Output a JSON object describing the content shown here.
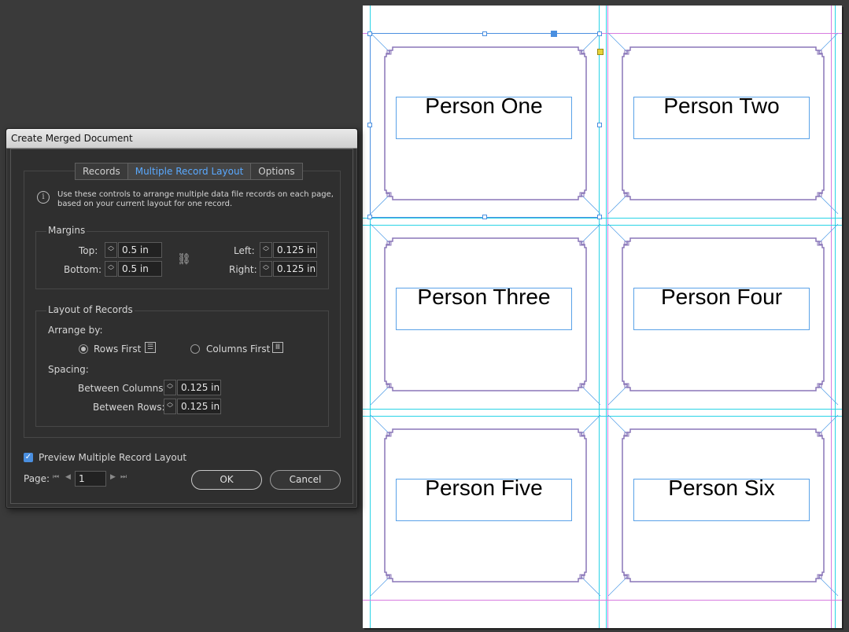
{
  "dialog": {
    "title": "Create Merged Document",
    "tabs": [
      "Records",
      "Multiple Record Layout",
      "Options"
    ],
    "active_tab": "Multiple Record Layout",
    "info_line1": "Use these controls to arrange multiple data file records on each page,",
    "info_line2": "based on your current layout for one record.",
    "margins": {
      "group_label": "Margins",
      "top_label": "Top:",
      "top_value": "0.5 in",
      "bottom_label": "Bottom:",
      "bottom_value": "0.5 in",
      "left_label": "Left:",
      "left_value": "0.125 in",
      "right_label": "Right:",
      "right_value": "0.125 in"
    },
    "layout": {
      "group_label": "Layout of Records",
      "arrange_label": "Arrange by:",
      "rows_first": "Rows First",
      "columns_first": "Columns First",
      "selected": "Rows First",
      "spacing_label": "Spacing:",
      "between_columns_label": "Between Columns:",
      "between_columns_value": "0.125 in",
      "between_rows_label": "Between Rows:",
      "between_rows_value": "0.125 in"
    },
    "preview_label": "Preview Multiple Record Layout",
    "preview_checked": true,
    "page_label": "Page:",
    "page_value": "1",
    "ok_label": "OK",
    "cancel_label": "Cancel"
  },
  "document": {
    "records": [
      "Person One",
      "Person Two",
      "Person Three",
      "Person Four",
      "Person Five",
      "Person Six"
    ]
  },
  "colors": {
    "guide_cyan": "#29d3e6",
    "margin_magenta": "#d77be0",
    "frame_purple": "#8a76b8",
    "selection_blue": "#4a8fe0",
    "active_tab_blue": "#5aa9ff"
  }
}
